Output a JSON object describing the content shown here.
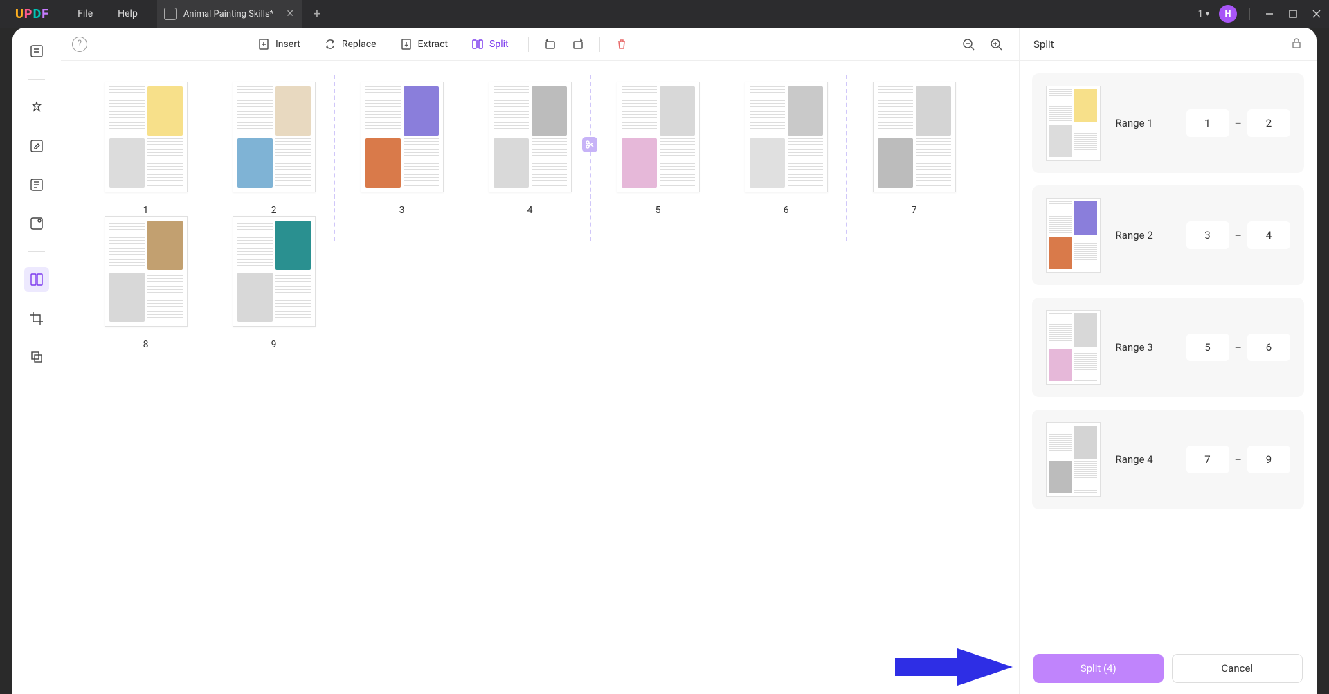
{
  "titlebar": {
    "file": "File",
    "help": "Help",
    "tab_title": "Animal Painting Skills*",
    "page_dropdown": "1",
    "avatar_initial": "H"
  },
  "toolbar": {
    "insert": "Insert",
    "replace": "Replace",
    "extract": "Extract",
    "split": "Split"
  },
  "pages": [
    1,
    2,
    3,
    4,
    5,
    6,
    7,
    8,
    9
  ],
  "split_dividers": [
    2,
    4,
    6
  ],
  "right": {
    "title": "Split",
    "ranges": [
      {
        "label": "Range 1",
        "from": 1,
        "to": 2
      },
      {
        "label": "Range 2",
        "from": 3,
        "to": 4
      },
      {
        "label": "Range 3",
        "from": 5,
        "to": 6
      },
      {
        "label": "Range 4",
        "from": 7,
        "to": 9
      }
    ],
    "primary": "Split (4)",
    "cancel": "Cancel"
  },
  "thumb_colors": {
    "1": [
      "#888",
      "#f7e08a",
      "#dcdcdc"
    ],
    "2": [
      "#f0d060",
      "#e8d9c0",
      "#7fb3d5"
    ],
    "3": [
      "#5a8adb",
      "#8a7edb",
      "#d97a4a"
    ],
    "4": [
      "#cfcfcf",
      "#bcbcbc",
      "#d9d9d9"
    ],
    "5": [
      "#2a8a8a",
      "#d8d8d8",
      "#e6b8d9"
    ],
    "6": [
      "#2a6b3e",
      "#c9c9c9",
      "#e0e0e0"
    ],
    "7": [
      "#7da83a",
      "#d4d4d4",
      "#bcbcbc"
    ],
    "8": [
      "#d8d8d8",
      "#c2a070",
      "#d8d8d8"
    ],
    "9": [
      "#d8d8d8",
      "#2a9090",
      "#d8d8d8"
    ]
  }
}
